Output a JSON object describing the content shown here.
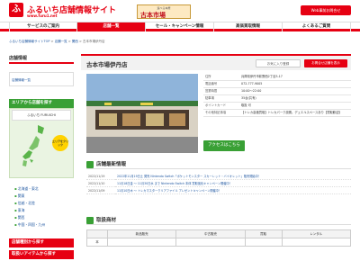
{
  "header": {
    "logo_mark": "ふ",
    "logo_text": "ふるいち店舗情報サイト",
    "logo_url": "www.furu1.net",
    "store_logo_sub": "遊べる本屋",
    "store_logo_main": "古本市場",
    "web_button": "Web事前お問合せ"
  },
  "nav": {
    "items": [
      {
        "label": "サービスのご案内",
        "active": false
      },
      {
        "label": "店舗一覧",
        "active": true
      },
      {
        "label": "セール・キャンペーン情報",
        "active": false
      },
      {
        "label": "高価買取情報",
        "active": false
      },
      {
        "label": "よくあるご質問",
        "active": false
      }
    ]
  },
  "breadcrumb": {
    "items": [
      "ふるいち店舗情報サイトTOP",
      "店舗一覧",
      "関西",
      "古本市場伊丹店"
    ],
    "separator": " > "
  },
  "sidebar": {
    "title": "店舗情報",
    "list_link": "店舗情報一覧",
    "area_title": "エリアから店舗を探す",
    "map_banner": "ふるいち  FURUICHI",
    "click_badge": "エリアをクリック",
    "regions": [
      "北海道・東北",
      "関東",
      "信越・北陸",
      "東海",
      "関西",
      "中国・四国・九州"
    ],
    "btn_brand": "店舗種別から探す",
    "btn_handling": "取扱いアイテムから探す"
  },
  "store": {
    "name": "古本市場伊丹店",
    "fav_button": "お気に入り登録",
    "guide_button": "お問合せ店舗を表示",
    "access_button": "アクセスはこちら",
    "info": [
      {
        "key": "住所",
        "value": "兵庫県伊丹市荻野西2丁目3-17"
      },
      {
        "key": "電話番号",
        "value": "072-777-9005"
      },
      {
        "key": "営業時間",
        "value": "10:00〜22:00"
      },
      {
        "key": "駐車場",
        "value": "35台(共有)"
      },
      {
        "key": "ポイントカード",
        "value": "取扱 可"
      },
      {
        "key": "その他特記事項",
        "value": "【トレカ高価買取】トレカパーク設置。デュエルスペースあり【買取歓迎】"
      }
    ]
  },
  "news": {
    "title": "店舗最新情報",
    "items": [
      {
        "date": "2022/11/19",
        "text": "2022年11月19日土 発売 Nintendo Switch「ポケットモンスター スカーレット・バイオレット」販売開始中！"
      },
      {
        "date": "2022/11/10",
        "text": "11月18日金 〜 11月30日水 まで Nintendo Switch 本体 買取強化キャンペーン開催中！"
      },
      {
        "date": "2022/11/09",
        "text": "11月10日木 〜 トレカマスタークリアファイル プレゼントキャンペーン開催中！"
      }
    ]
  },
  "items": {
    "title": "取扱商材",
    "headers": [
      "",
      "新品販売",
      "中古販売",
      "買取",
      "レンタル"
    ],
    "rows": [
      {
        "label": "本",
        "cells": [
          "",
          "",
          "",
          ""
        ]
      }
    ]
  },
  "colors": {
    "brand_red": "#e60012",
    "green": "#39a035"
  }
}
